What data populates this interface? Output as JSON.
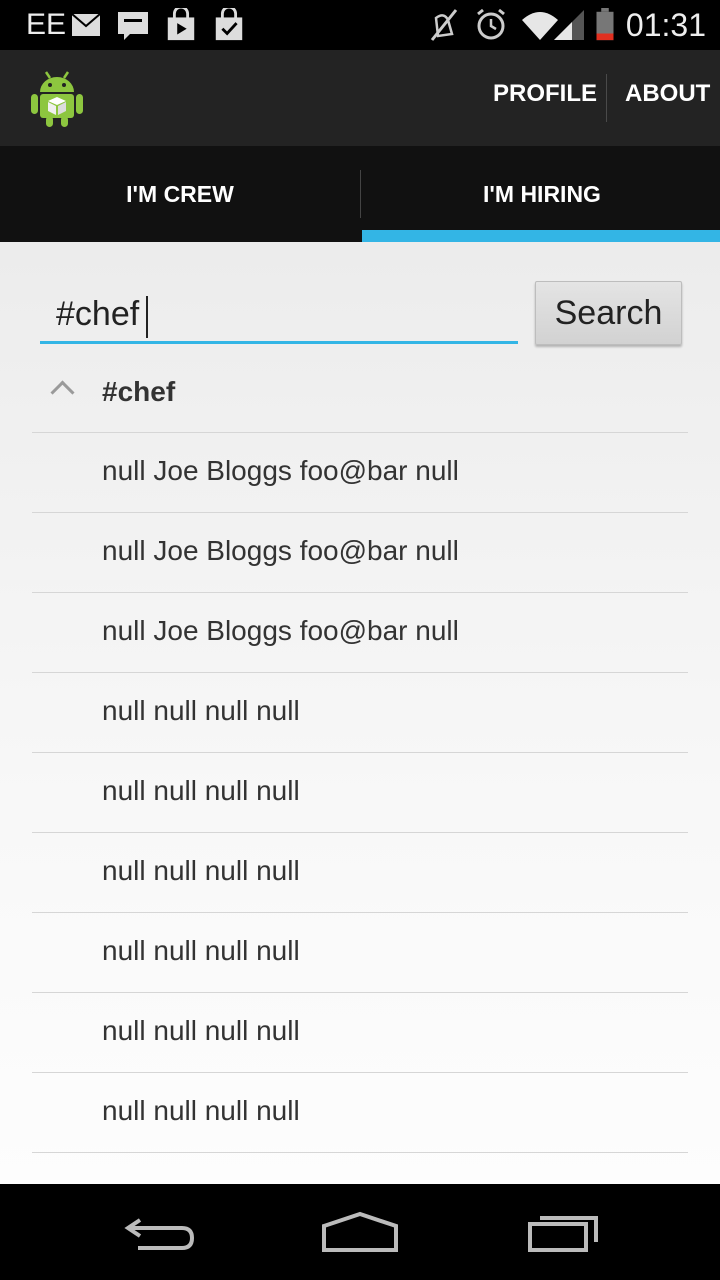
{
  "status_bar": {
    "carrier": "EE",
    "time": "01:31",
    "icons": [
      "mail-icon",
      "chat-icon",
      "shopping-bag-icon",
      "checked-bag-icon",
      "mute-icon",
      "alarm-icon",
      "wifi-icon",
      "signal-icon",
      "battery-icon"
    ]
  },
  "action_bar": {
    "logo": "android-logo-icon",
    "profile_label": "PROFILE",
    "about_label": "ABOUT"
  },
  "tabs": [
    {
      "label": "I'M CREW",
      "selected": false
    },
    {
      "label": "I'M HIRING",
      "selected": true
    }
  ],
  "colors": {
    "accent": "#33b5e5",
    "action_bar": "#232323",
    "tab_bar": "#111111"
  },
  "search": {
    "value": "#chef",
    "button_label": "Search"
  },
  "group": {
    "label": "#chef",
    "expanded": true
  },
  "results": [
    "null Joe Bloggs foo@bar null",
    "null Joe Bloggs foo@bar null",
    "null Joe Bloggs foo@bar null",
    "null null null null",
    "null null null null",
    "null null null null",
    "null null null null",
    "null null null null",
    "null null null null"
  ],
  "nav_bar": {
    "icons": [
      "back-icon",
      "home-icon",
      "recent-apps-icon"
    ]
  }
}
